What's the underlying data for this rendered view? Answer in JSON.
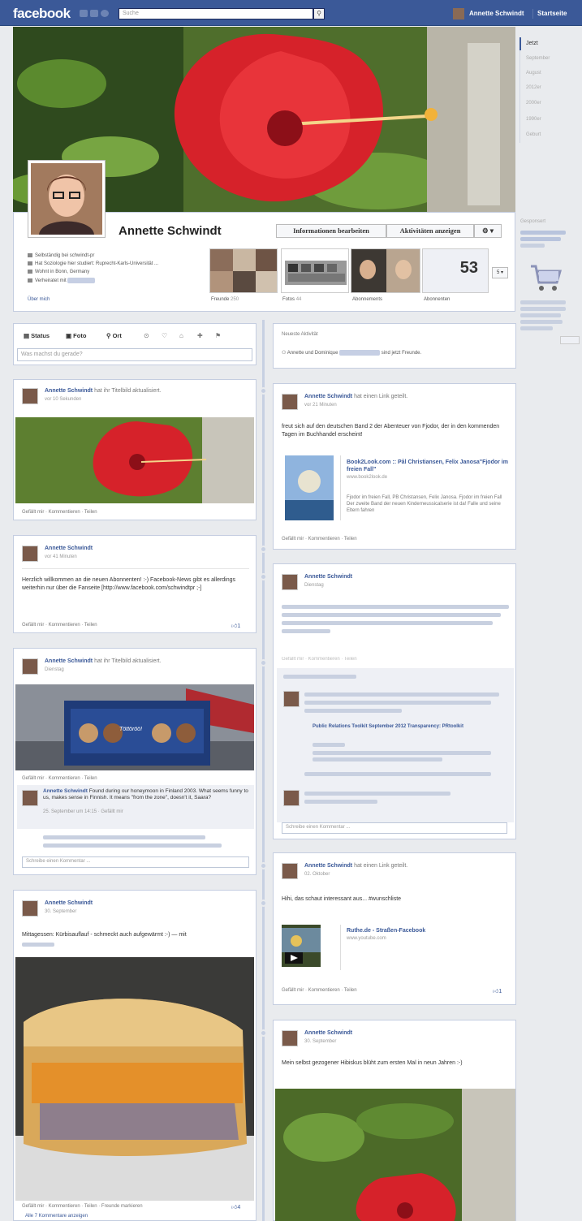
{
  "topbar": {
    "logo": "facebook",
    "search_placeholder": "Suche",
    "search_icon": "search-icon",
    "user_name": "Annette Schwindt",
    "home": "Startseite"
  },
  "profile": {
    "name": "Annette Schwindt",
    "btn_edit": "Informationen bearbeiten",
    "btn_activity": "Aktivitäten anzeigen",
    "btn_settings": "⚙ ▾",
    "info": [
      "Selbständig bei schwindt-pr",
      "Hat Soziologie hier studiert: Ruprecht-Karls-Universität ...",
      "Wohnt in Bonn, Germany",
      "Verheiratet mit"
    ],
    "about": "Über mich",
    "tiles": {
      "friends": "Freunde",
      "friends_count": "250",
      "photos": "Fotos",
      "photos_count": "44",
      "subscriptions": "Abonnements",
      "subscribers": "Abonnenten",
      "subscribers_count": "53",
      "more": "5 ▾"
    }
  },
  "composer": {
    "tabs": [
      "Status",
      "Foto",
      "Ort"
    ],
    "placeholder": "Was machst du gerade?"
  },
  "left_posts": [
    {
      "name": "Annette Schwindt",
      "suffix": "hat ihr Titelbild aktualisiert.",
      "time": "vor 10 Sekunden",
      "actions": "Gefällt mir · Kommentieren · Teilen"
    },
    {
      "name": "Annette Schwindt",
      "time": "vor 41 Minuten",
      "text": "Herzlich willkommen an die neuen Abonnenten! :-) Facebook-News gibt es allerdings weiterhin nur über die Fanseite [http://www.facebook.com/schwindtpr ;-]",
      "actions": "Gefällt mir · Kommentieren · Teilen",
      "likes": "1"
    },
    {
      "name": "Annette Schwindt",
      "suffix": "hat ihr Titelbild aktualisiert.",
      "time": "Dienstag",
      "actions": "Gefällt mir · Kommentieren · Teilen",
      "image_text": "Töttöröö!",
      "comment_name": "Annette Schwindt",
      "comment": "Found during our honeymoon in Finland 2003. What seems funny to us, makes sense in Finnish. It means \"from the zone\", doesn't it, Saara?",
      "comment_time": "25. September um 14:15 · Gefällt mir",
      "comment_box": "Schreibe einen Kommentar ..."
    },
    {
      "name": "Annette Schwindt",
      "time": "30. September",
      "text": "Mittagessen: Kürbisauflauf - schmeckt auch aufgewärmt :-) — mit",
      "actions": "Gefällt mir · Kommentieren · Teilen · Freunde markieren",
      "likes": "4",
      "more_comments": "Alle 7 Kommentare anzeigen"
    }
  ],
  "right_posts": [
    {
      "header": "Neueste Aktivität",
      "text_a": "Annette und Dominique",
      "text_b": "sind jetzt Freunde."
    },
    {
      "name": "Annette Schwindt",
      "suffix": "hat einen Link geteilt.",
      "time": "vor 21 Minuten",
      "text": "freut sich auf den deutschen Band 2 der Abenteuer von Fjodor, der in den kommenden Tagen im Buchhandel erscheint!",
      "link_title": "Book2Look.com :: Pål Christiansen, Felix Janosa\"Fjodor im freien Fall\"",
      "link_url": "www.book2look.de",
      "link_desc": "Fjodor im freien Fall, PB Christansen, Felix Janosa. Fjodor im freien Fall Der zweite Band der neuen Kinderneussicalserie ist da! Falle und seine Eltern fahren",
      "actions": "Gefällt mir · Kommentieren · Teilen"
    },
    {
      "name": "Annette Schwindt",
      "time": "Dienstag",
      "actions": "Gefällt mir · Kommentieren · Teilen",
      "comment_box": "Schreibe einen Kommentar ...",
      "link_title": "Public Relations Toolkit September 2012 Transparency: PRtoolkit"
    },
    {
      "name": "Annette Schwindt",
      "suffix": "hat einen Link geteilt.",
      "time": "02. Oktober",
      "text": "Hihi, das schaut interessant aus... #wunschliste",
      "link_title": "Ruthe.de - Straßen-Facebook",
      "link_url": "www.youtube.com",
      "actions": "Gefällt mir · Kommentieren · Teilen",
      "likes": "1"
    },
    {
      "name": "Annette Schwindt",
      "time": "30. September",
      "text": "Mein selbst gezogener Hibiskus blüht zum ersten Mal in neun Jahren :-)"
    }
  ],
  "scrubber": [
    "Jetzt",
    "September",
    "August",
    "2012er",
    "2000er",
    "1990er",
    "Geburt"
  ],
  "ad": {
    "label": "Gesponsert"
  }
}
